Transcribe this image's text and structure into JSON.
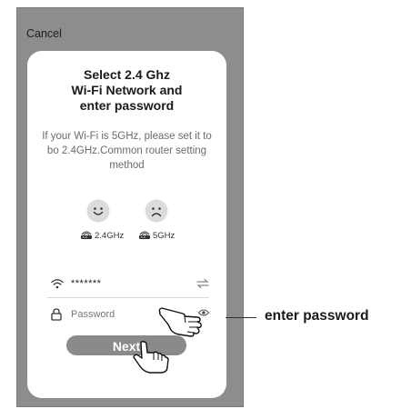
{
  "header": {
    "cancel_label": "Cancel"
  },
  "card": {
    "title_lines": [
      "Select 2.4 Ghz",
      "Wi-Fi Network and",
      "enter password"
    ],
    "subtitle_lines": [
      "If your Wi-Fi is 5GHz, please set it to",
      "bo 2.4GHz.Common router setting",
      "method"
    ]
  },
  "bands": [
    {
      "label": "2.4GHz",
      "face": "smile-face-icon",
      "router": "router-icon"
    },
    {
      "label": "5GHz",
      "face": "sad-face-icon",
      "router": "router-icon"
    }
  ],
  "wifi_row": {
    "icon": "wifi-icon",
    "ssid_value": "*******",
    "switch_icon": "switch-network-icon"
  },
  "password_row": {
    "icon": "lock-icon",
    "placeholder": "Password",
    "value": "",
    "toggle_icon": "eye-icon"
  },
  "next_button": {
    "label": "Next"
  },
  "annotation": {
    "label": "enter password",
    "pointer_icons": [
      "pointing-hand-icon",
      "pointing-hand-icon"
    ]
  },
  "colors": {
    "frame": "#8d8d8d",
    "card": "#ffffff",
    "button": "#8a8a8a",
    "button_text": "#ffffff",
    "text_dark": "#1a1a1a",
    "text_muted": "#6a6a6a"
  }
}
